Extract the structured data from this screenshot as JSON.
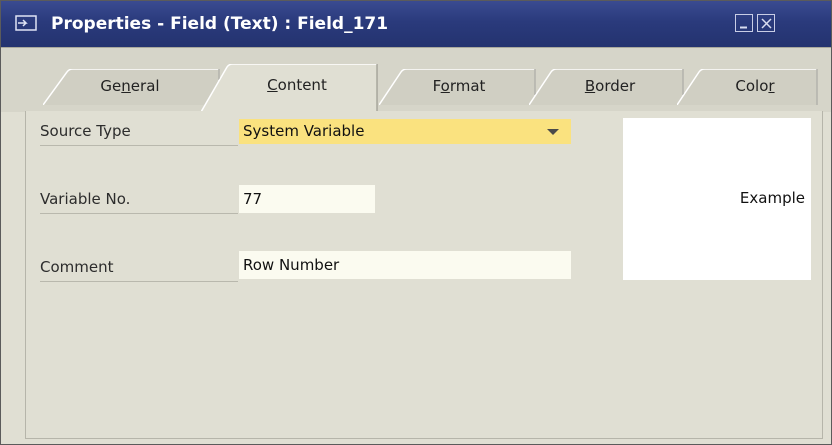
{
  "window": {
    "title": "Properties - Field (Text) : Field_171",
    "minimize_icon": "minimize-icon",
    "close_icon": "close-icon"
  },
  "tabs": [
    {
      "label_pre": "Ge",
      "label_mnemonic": "n",
      "label_post": "eral",
      "selected": false
    },
    {
      "label_pre": "",
      "label_mnemonic": "C",
      "label_post": "ontent",
      "selected": true
    },
    {
      "label_pre": "F",
      "label_mnemonic": "o",
      "label_post": "rmat",
      "selected": false
    },
    {
      "label_pre": "",
      "label_mnemonic": "B",
      "label_post": "order",
      "selected": false
    },
    {
      "label_pre": "Colo",
      "label_mnemonic": "r",
      "label_post": "",
      "selected": false
    }
  ],
  "form": {
    "source_type_label": "Source Type",
    "source_type_value": "System Variable",
    "variable_no_label": "Variable No.",
    "variable_no_value": "77",
    "comment_label": "Comment",
    "comment_value": "Row Number"
  },
  "preview": {
    "text": "Example"
  },
  "colors": {
    "titlebar": "#2a3a7c",
    "dropdown_highlight": "#fae27f",
    "window_background": "#e0dfd3"
  }
}
